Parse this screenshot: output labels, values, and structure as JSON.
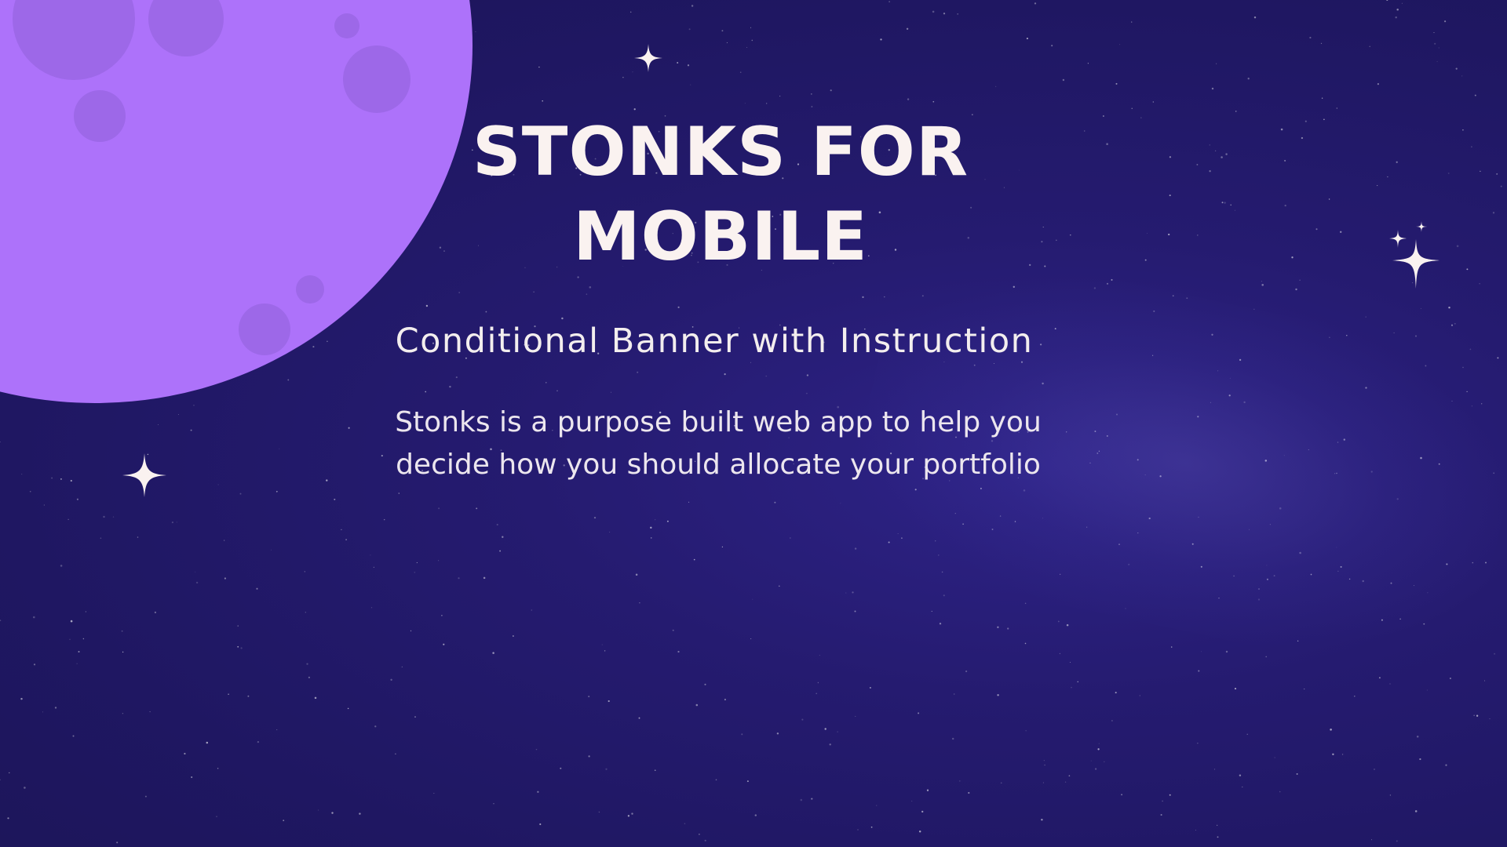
{
  "slide": {
    "title": "STONKS FOR MOBILE",
    "subtitle": "Conditional Banner with Instruction",
    "description": "Stonks is a purpose built web app to help you decide how you should allocate your portfolio"
  },
  "decor": {
    "moon": "moon-illustration",
    "sparkles": [
      "sparkle-icon",
      "sparkle-icon",
      "sparkle-cluster-icon"
    ]
  },
  "colors": {
    "background": "#221968",
    "moon": "#ad72fa",
    "moon_crater": "#9d68e8",
    "text": "#faf2f0"
  }
}
